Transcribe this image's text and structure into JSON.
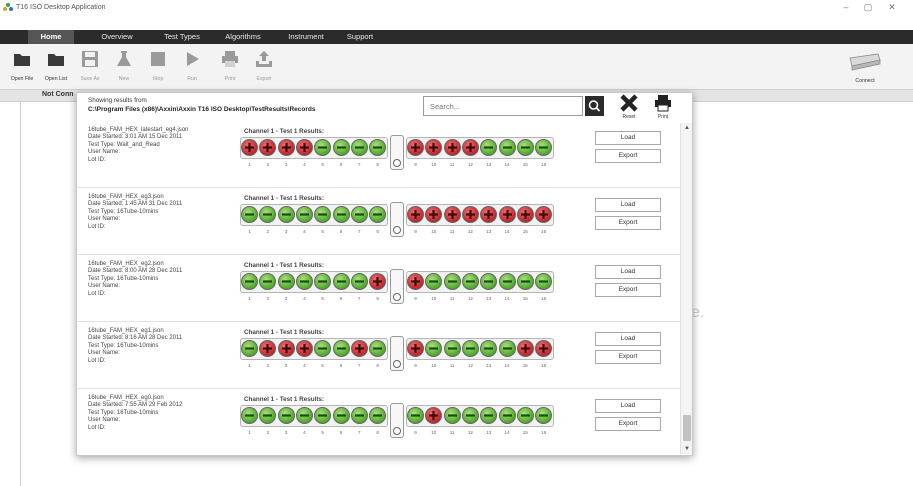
{
  "window": {
    "title": "T16 ISO Desktop Application",
    "controls": [
      "–",
      "▢",
      "✕"
    ]
  },
  "nav": {
    "tabs": [
      "Home",
      "Overview",
      "Test Types",
      "Algorithms",
      "Instrument",
      "Support"
    ],
    "active": "Home",
    "brand": "axxin"
  },
  "toolbar": {
    "open_file": "Open File",
    "open_list": "Open List",
    "save_as": "Save As",
    "new": "New",
    "stop": "Stop",
    "run": "Run",
    "print": "Print",
    "export": "Export",
    "connect": "Connect"
  },
  "status": {
    "connection": "Not Conn"
  },
  "background": {
    "partial_text": "e."
  },
  "dialog": {
    "showing_label": "Showing results from",
    "path": "C:\\Program Files (x86)\\Axxin\\Axxin T16 ISO Desktop\\TestResults\\Records",
    "search_placeholder": "Search...",
    "reset_label": "Reset",
    "print_label": "Print",
    "load_label": "Load",
    "export_label": "Export",
    "channel_label": "Channel 1 - Test 1 Results:",
    "tube_numbers": [
      "1",
      "2",
      "3",
      "4",
      "5",
      "6",
      "7",
      "8",
      "9",
      "10",
      "11",
      "12",
      "13",
      "14",
      "15",
      "16"
    ],
    "records": [
      {
        "file": "16tube_FAM_HEX_latestart_eg4.json",
        "date": "Date Started: 3:01 AM 15 Dec 2011",
        "test_type": "Test Type: Wait_and_Read",
        "user": "User Name:",
        "lot": "Lot ID:",
        "results": [
          "+",
          "+",
          "+",
          "+",
          "-",
          "-",
          "-",
          "-",
          "+",
          "+",
          "+",
          "+",
          "-",
          "-",
          "-",
          "-"
        ]
      },
      {
        "file": "16tube_FAM_HEX_eg3.json",
        "date": "Date Started: 1:45 AM 31 Dec 2011",
        "test_type": "Test Type: 16Tube-10mins",
        "user": "User Name:",
        "lot": "Lot ID:",
        "results": [
          "-",
          "-",
          "-",
          "-",
          "-",
          "-",
          "-",
          "-",
          "+",
          "+",
          "+",
          "+",
          "+",
          "+",
          "+",
          "+"
        ]
      },
      {
        "file": "16tube_FAM_HEX_eg2.json",
        "date": "Date Started: 8:00 AM 28 Dec 2011",
        "test_type": "Test Type: 16Tube-10mins",
        "user": "User Name:",
        "lot": "Lot ID:",
        "results": [
          "-",
          "-",
          "-",
          "-",
          "-",
          "-",
          "-",
          "+",
          "+",
          "-",
          "-",
          "-",
          "-",
          "-",
          "-",
          "-"
        ]
      },
      {
        "file": "16tube_FAM_HEX_eg1.json",
        "date": "Date Started: 8:16 AM 28 Dec 2011",
        "test_type": "Test Type: 16Tube-10mins",
        "user": "User Name:",
        "lot": "Lot ID:",
        "results": [
          "-",
          "+",
          "+",
          "+",
          "-",
          "-",
          "+",
          "-",
          "+",
          "-",
          "-",
          "-",
          "-",
          "-",
          "+",
          "+"
        ]
      },
      {
        "file": "16tube_FAM_HEX_eg0.json",
        "date": "Date Started: 7:55 AM 29 Feb 2012",
        "test_type": "Test Type: 16Tube-10mins",
        "user": "User Name:",
        "lot": "Lot ID:",
        "results": [
          "-",
          "-",
          "-",
          "-",
          "-",
          "-",
          "-",
          "-",
          "-",
          "+",
          "-",
          "-",
          "-",
          "-",
          "-",
          "-"
        ]
      }
    ]
  },
  "colors": {
    "nav_bg": "#2b2b2b",
    "positive": "#c0252b",
    "negative": "#4ea92c"
  }
}
